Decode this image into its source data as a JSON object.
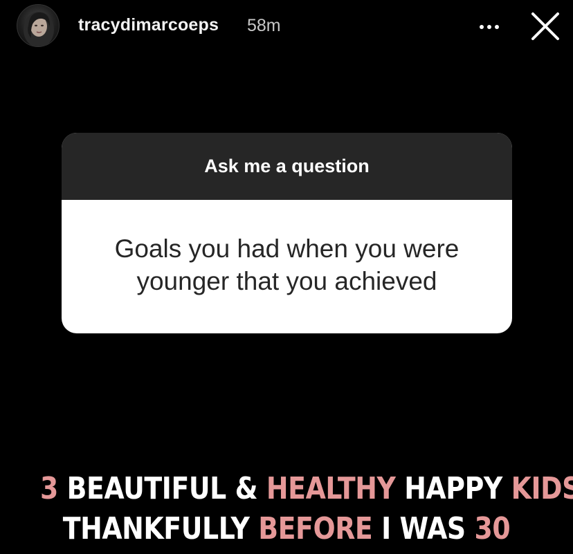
{
  "header": {
    "username": "tracydimarcoeps",
    "timestamp": "58m",
    "avatar_icon": "profile-avatar",
    "more_icon": "more-horizontal-icon",
    "close_icon": "close-icon"
  },
  "question_sticker": {
    "title": "Ask me a question",
    "question": "Goals you had when you were younger that you achieved"
  },
  "caption": {
    "line1": [
      {
        "text": "3 ",
        "accent": true
      },
      {
        "text": "BEAUTIFUL & ",
        "accent": false
      },
      {
        "text": "HEALTHY",
        "accent": true
      },
      {
        "text": " HAPPY ",
        "accent": false
      },
      {
        "text": "KIDS",
        "accent": true
      }
    ],
    "line2": [
      {
        "text": "THANKFULLY ",
        "accent": false
      },
      {
        "text": "BEFORE",
        "accent": true
      },
      {
        "text": " I WAS ",
        "accent": false
      },
      {
        "text": "30",
        "accent": true
      }
    ]
  },
  "colors": {
    "background": "#000000",
    "card_header": "#262626",
    "card_body": "#ffffff",
    "caption_white": "#ffffff",
    "caption_accent": "#e59898"
  }
}
